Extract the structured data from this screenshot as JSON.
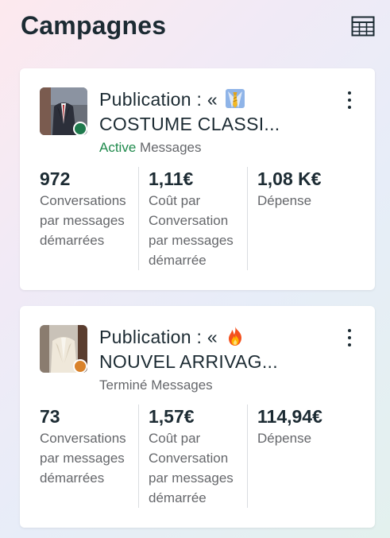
{
  "header": {
    "title": "Campagnes",
    "table_icon": "table-grid-icon"
  },
  "campaigns": [
    {
      "title_line1": "Publication : «",
      "emoji": "necktie-emoji-icon",
      "title_line2": "COSTUME CLASSI...",
      "status": "Active",
      "status_color": "#1f8a4c",
      "objective": "Messages",
      "metrics": [
        {
          "value": "972",
          "label": "Conversations\npar messages\ndémarrées"
        },
        {
          "value": "1,11€",
          "label": "Coût par\nConversation\npar messages\ndémarrée"
        },
        {
          "value": "1,08 K€",
          "label": "Dépense"
        }
      ]
    },
    {
      "title_line1": "Publication : «",
      "emoji": "fire-emoji-icon",
      "title_line2": "NOUVEL ARRIVAG...",
      "status": "Terminé",
      "status_color": "#d9822b",
      "objective": "Messages",
      "metrics": [
        {
          "value": "73",
          "label": "Conversations\npar messages\ndémarrées"
        },
        {
          "value": "1,57€",
          "label": "Coût par\nConversation\npar messages\ndémarrée"
        },
        {
          "value": "114,94€",
          "label": "Dépense"
        }
      ]
    }
  ]
}
